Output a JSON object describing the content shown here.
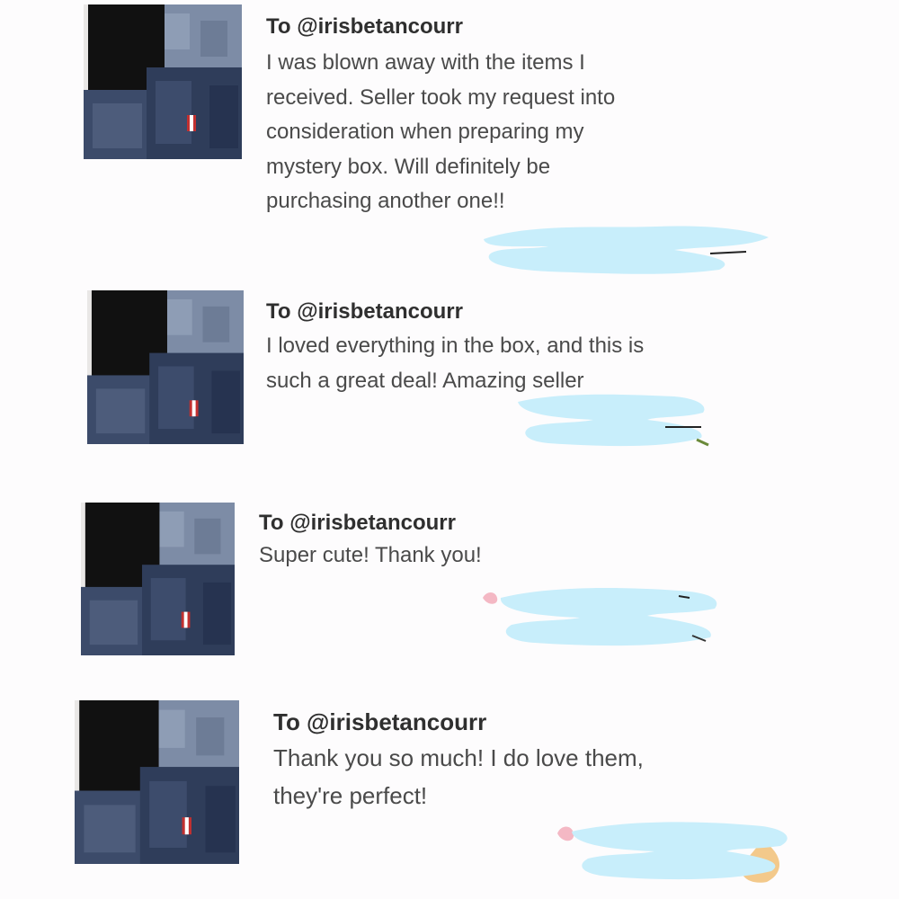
{
  "reviews": [
    {
      "recipient": "To @irisbetancourr",
      "text": "I was blown away with the items I\nreceived. Seller took my request into\nconsideration when preparing my\nmystery box. Will definitely be\npurchasing another one!!",
      "thumbnail_icon": "denim-clothing-photo",
      "redaction_icon": "blue-scribble-redaction"
    },
    {
      "recipient": "To @irisbetancourr",
      "text": "I loved everything in the box, and this is\nsuch a great deal! Amazing seller",
      "thumbnail_icon": "denim-clothing-photo",
      "redaction_icon": "blue-scribble-redaction"
    },
    {
      "recipient": "To @irisbetancourr",
      "text": "Super cute! Thank you!",
      "thumbnail_icon": "denim-clothing-photo",
      "redaction_icon": "blue-scribble-redaction"
    },
    {
      "recipient": "To @irisbetancourr",
      "text": "Thank you so much! I do love them,\nthey're perfect!",
      "thumbnail_icon": "denim-clothing-photo",
      "redaction_icon": "blue-scribble-redaction"
    }
  ],
  "colors": {
    "background": "#fdfcfd",
    "redaction_blue": "#c8eefb",
    "denim_dark": "#2f3d5a",
    "denim_light": "#7f8ea6",
    "black_garment": "#111111"
  }
}
